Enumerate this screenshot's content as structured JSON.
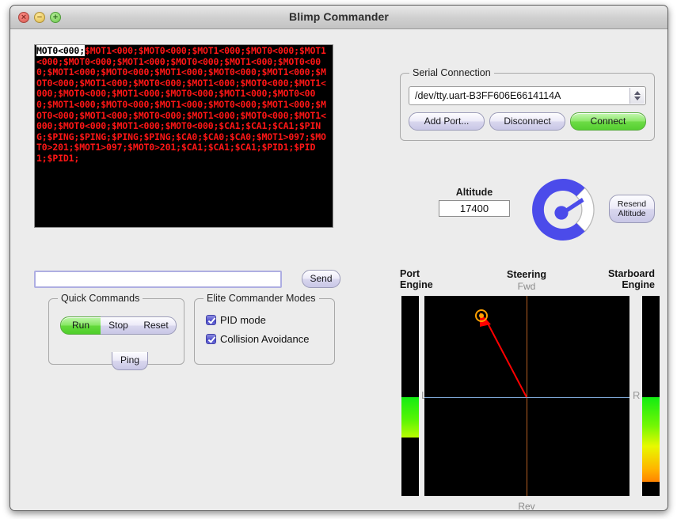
{
  "window": {
    "title": "Blimp Commander",
    "controls": [
      {
        "name": "close-button",
        "glyph": "×"
      },
      {
        "name": "minimize-button",
        "glyph": "−"
      },
      {
        "name": "zoom-button",
        "glyph": "+"
      }
    ]
  },
  "terminal": {
    "selected_text": "MOT0<000;",
    "text": "$MOT1<000;$MOT0<000;$MOT1<000;$MOT0<000;$MOT1<000;$MOT0<000;$MOT1<000;$MOT0<000;$MOT1<000;$MOT0<000;$MOT1<000;$MOT0<000;$MOT1<000;$MOT0<000;$MOT1<000;$MOT0<000;$MOT1<000;$MOT0<000;$MOT1<000;$MOT0<000;$MOT1<000;$MOT0<000;$MOT1<000;$MOT0<000;$MOT1<000;$MOT0<000;$MOT1<000;$MOT0<000;$MOT1<000;$MOT0<000;$MOT1<000;$MOT0<000;$MOT1<000;$MOT0<000;$MOT1<000;$MOT0<000;$MOT1<000;$MOT0<000;$MOT1<000;$MOT0<000;$CA1;$CA1;$CA1;$PING;$PING;$PING;$PING;$PING;$CA0;$CA0;$CA0;$MOT1>097;$MOT0>201;$MOT1>097;$MOT0>201;$CA1;$CA1;$CA1;$PID1;$PID1;$PID1;",
    "text_color": "#ff1616",
    "background_color": "#000000"
  },
  "command_bar": {
    "input_value": "",
    "input_placeholder": "",
    "send_label": "Send"
  },
  "quick_commands": {
    "legend": "Quick Commands",
    "buttons": [
      {
        "label": "Run",
        "active": true
      },
      {
        "label": "Stop",
        "active": false
      },
      {
        "label": "Reset",
        "active": false
      },
      {
        "label": "Ping",
        "active": false
      }
    ]
  },
  "elite_modes": {
    "legend": "Elite Commander Modes",
    "options": [
      {
        "label": "PID mode",
        "checked": true
      },
      {
        "label": "Collision Avoidance",
        "checked": true
      }
    ]
  },
  "serial": {
    "legend": "Serial Connection",
    "port_value": "/dev/tty.uart-B3FF606E6614114A",
    "add_port_label": "Add Port...",
    "disconnect_label": "Disconnect",
    "connect_label": "Connect",
    "connect_color": "#6ddc46"
  },
  "altitude": {
    "label": "Altitude",
    "value": "17400",
    "resend_line1": "Resend",
    "resend_line2": "Altitude",
    "gauge_fill_color": "#4b4bea",
    "gauge_percent": 75
  },
  "steering": {
    "port_engine_line1": "Port",
    "port_engine_line2": "Engine",
    "starboard_engine_line1": "Starboard",
    "starboard_engine_line2": "Engine",
    "title": "Steering",
    "forward_label": "Fwd",
    "reverse_label": "Rev",
    "left_label": "L",
    "right_label": "R",
    "vector_color": "#ff0000",
    "marker_color": "#ffa000",
    "vertical_axis_color": "#b45f22",
    "horizontal_axis_color": "#7ea7d6"
  }
}
